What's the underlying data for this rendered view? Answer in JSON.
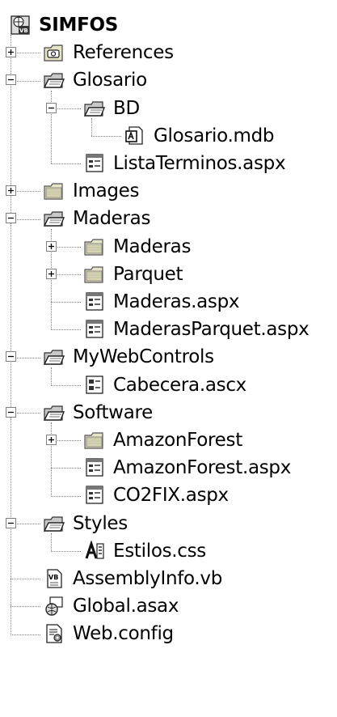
{
  "tree": [
    {
      "label": "SIMFOS",
      "icon": "vb-project-icon",
      "level": 0,
      "expander": "none",
      "bold": true
    },
    {
      "label": "References",
      "icon": "references-folder-icon",
      "level": 0,
      "expander": "plus"
    },
    {
      "label": "Glosario",
      "icon": "folder-open-icon",
      "level": 0,
      "expander": "minus"
    },
    {
      "label": "BD",
      "icon": "folder-open-icon",
      "level": 1,
      "expander": "minus"
    },
    {
      "label": "Glosario.mdb",
      "icon": "access-database-icon",
      "level": 2,
      "expander": "none"
    },
    {
      "label": "ListaTerminos.aspx",
      "icon": "aspx-page-icon",
      "level": 1,
      "expander": "none"
    },
    {
      "label": "Images",
      "icon": "folder-closed-icon",
      "level": 0,
      "expander": "plus"
    },
    {
      "label": "Maderas",
      "icon": "folder-open-icon",
      "level": 0,
      "expander": "minus"
    },
    {
      "label": "Maderas",
      "icon": "folder-closed-icon",
      "level": 1,
      "expander": "plus"
    },
    {
      "label": "Parquet",
      "icon": "folder-closed-icon",
      "level": 1,
      "expander": "plus"
    },
    {
      "label": "Maderas.aspx",
      "icon": "aspx-page-icon",
      "level": 1,
      "expander": "none"
    },
    {
      "label": "MaderasParquet.aspx",
      "icon": "aspx-page-icon",
      "level": 1,
      "expander": "none"
    },
    {
      "label": "MyWebControls",
      "icon": "folder-open-icon",
      "level": 0,
      "expander": "minus"
    },
    {
      "label": "Cabecera.ascx",
      "icon": "ascx-control-icon",
      "level": 1,
      "expander": "none"
    },
    {
      "label": "Software",
      "icon": "folder-open-icon",
      "level": 0,
      "expander": "minus"
    },
    {
      "label": "AmazonForest",
      "icon": "folder-closed-icon",
      "level": 1,
      "expander": "plus"
    },
    {
      "label": "AmazonForest.aspx",
      "icon": "aspx-page-icon",
      "level": 1,
      "expander": "none"
    },
    {
      "label": "CO2FIX.aspx",
      "icon": "aspx-page-icon",
      "level": 1,
      "expander": "none"
    },
    {
      "label": "Styles",
      "icon": "folder-open-icon",
      "level": 0,
      "expander": "minus"
    },
    {
      "label": "Estilos.css",
      "icon": "css-file-icon",
      "level": 1,
      "expander": "none"
    },
    {
      "label": "AssemblyInfo.vb",
      "icon": "vb-file-icon",
      "level": 0,
      "expander": "none"
    },
    {
      "label": "Global.asax",
      "icon": "global-asax-icon",
      "level": 0,
      "expander": "none"
    },
    {
      "label": "Web.config",
      "icon": "config-file-icon",
      "level": 0,
      "expander": "none"
    }
  ]
}
